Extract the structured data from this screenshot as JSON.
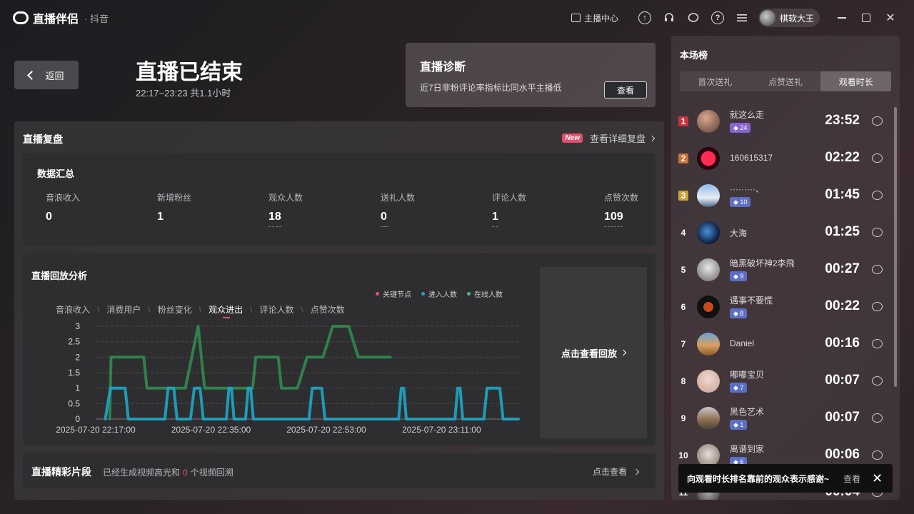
{
  "titlebar": {
    "app_name": "直播伴侣",
    "platform": "· 抖音",
    "streamer_center": "主播中心",
    "username": "棋软大王"
  },
  "header": {
    "back_label": "返回",
    "status_title": "直播已结束",
    "time_range": "22:17~23:23 共1.1小时"
  },
  "diagnosis": {
    "title": "直播诊断",
    "desc": "近7日非粉评论率指标比同水平主播低",
    "button": "查看"
  },
  "replay": {
    "title": "直播复盘",
    "new_badge": "New",
    "detail_link": "查看详细复盘"
  },
  "summary": {
    "title": "数据汇总",
    "stats": [
      {
        "label": "音浪收入",
        "value": "0"
      },
      {
        "label": "新增粉丝",
        "value": "1"
      },
      {
        "label": "观众人数",
        "value": "18"
      },
      {
        "label": "送礼人数",
        "value": "0"
      },
      {
        "label": "评论人数",
        "value": "1"
      },
      {
        "label": "点赞次数",
        "value": "109"
      }
    ]
  },
  "analysis": {
    "title": "直播回放分析",
    "legend": [
      "关键节点",
      "进入人数",
      "在线人数"
    ],
    "tabs": [
      "音浪收入",
      "消费用户",
      "粉丝变化",
      "观众进出",
      "评论人数",
      "点赞次数"
    ],
    "active_tab": 3,
    "replay_link": "点击查看回放"
  },
  "chart_data": {
    "type": "line",
    "x_labels": [
      "2025-07-20 22:17:00",
      "2025-07-20 22:35:00",
      "2025-07-20 22:53:00",
      "2025-07-20 23:11:00"
    ],
    "y_ticks": [
      "3",
      "2.5",
      "2",
      "1.5",
      "1",
      "0.5",
      "0"
    ],
    "ylim": [
      0,
      3
    ],
    "xlim_minutes": [
      0,
      66
    ],
    "series": [
      {
        "name": "在线人数",
        "color": "#2f8f4f",
        "points": [
          [
            2.2,
            0
          ],
          [
            2.4,
            2
          ],
          [
            7.5,
            2
          ],
          [
            8,
            1
          ],
          [
            14,
            1
          ],
          [
            16,
            3
          ],
          [
            17,
            1
          ],
          [
            24.5,
            1
          ],
          [
            25,
            2
          ],
          [
            28.5,
            2
          ],
          [
            29,
            1
          ],
          [
            31.5,
            1
          ],
          [
            33,
            2
          ],
          [
            35.5,
            2
          ],
          [
            37,
            3
          ],
          [
            39.5,
            3
          ],
          [
            41,
            2
          ],
          [
            46,
            2
          ]
        ]
      },
      {
        "name": "进入人数",
        "color": "#1ca7c6",
        "points": [
          [
            1.5,
            0
          ],
          [
            2.3,
            1
          ],
          [
            4.6,
            1
          ],
          [
            5.1,
            0
          ],
          [
            10.8,
            0
          ],
          [
            11.3,
            1
          ],
          [
            12.2,
            1
          ],
          [
            12.7,
            0
          ],
          [
            14.8,
            0
          ],
          [
            15.4,
            1
          ],
          [
            16.3,
            1
          ],
          [
            16.8,
            0
          ],
          [
            20.4,
            0
          ],
          [
            20.8,
            1
          ],
          [
            21.2,
            1
          ],
          [
            21.6,
            0
          ],
          [
            23.4,
            0
          ],
          [
            23.8,
            1
          ],
          [
            24.2,
            1
          ],
          [
            24.6,
            0
          ],
          [
            33.3,
            0
          ],
          [
            33.8,
            1
          ],
          [
            35.3,
            1
          ],
          [
            35.8,
            0
          ],
          [
            47.3,
            0
          ],
          [
            47.7,
            1
          ],
          [
            48.1,
            1
          ],
          [
            48.5,
            0
          ],
          [
            56.1,
            0
          ],
          [
            56.5,
            1
          ],
          [
            56.9,
            1
          ],
          [
            57.3,
            0
          ],
          [
            60.6,
            0
          ],
          [
            61.1,
            1
          ],
          [
            63.1,
            1
          ],
          [
            63.6,
            0
          ],
          [
            66,
            0
          ]
        ]
      }
    ]
  },
  "highlights": {
    "title": "直播精彩片段",
    "desc_prefix": "已经生成视频高光和",
    "count": "0",
    "desc_suffix": "个视频回溯",
    "link": "点击查看"
  },
  "ranking": {
    "title": "本场榜",
    "tabs": [
      "首次送礼",
      "点赞送礼",
      "观看时长"
    ],
    "active_tab": 2,
    "rows": [
      {
        "rank": "1",
        "name": "就这么走",
        "badge": "24",
        "time": "23:52"
      },
      {
        "rank": "2",
        "name": "160615317",
        "badge": "",
        "time": "02:22"
      },
      {
        "rank": "3",
        "name": "·········、",
        "badge": "10",
        "time": "01:45"
      },
      {
        "rank": "4",
        "name": "大海",
        "badge": "",
        "time": "01:25"
      },
      {
        "rank": "5",
        "name": "暗黑破坏神2李飛",
        "badge": "9",
        "time": "00:27"
      },
      {
        "rank": "6",
        "name": "遇事不要慌",
        "badge": "8",
        "time": "00:22"
      },
      {
        "rank": "7",
        "name": "Daniel",
        "badge": "",
        "time": "00:16"
      },
      {
        "rank": "8",
        "name": "嘟嘟宝贝",
        "badge": "7",
        "time": "00:07"
      },
      {
        "rank": "9",
        "name": "黑色艺术",
        "badge": "1",
        "time": "00:07"
      },
      {
        "rank": "10",
        "name": "离谱到家",
        "badge": "6",
        "time": "00:06"
      },
      {
        "rank": "11",
        "name": "",
        "badge": "",
        "time": "00:04"
      }
    ]
  },
  "toast": {
    "text": "向观看时长排名靠前的观众表示感谢~",
    "view": "查看"
  }
}
